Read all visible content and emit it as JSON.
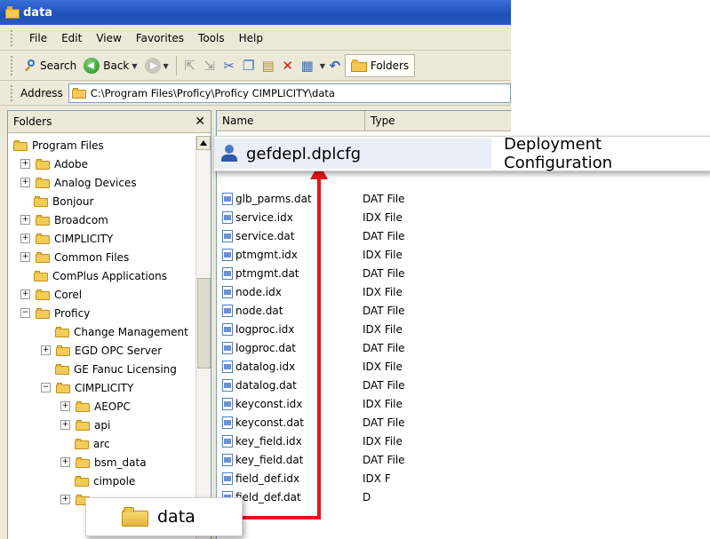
{
  "window": {
    "title": "data"
  },
  "menu": [
    "File",
    "Edit",
    "View",
    "Favorites",
    "Tools",
    "Help"
  ],
  "toolbar": {
    "search_label": "Search",
    "back_label": "Back",
    "folders_label": "Folders"
  },
  "address": {
    "label": "Address",
    "path": "C:\\Program Files\\Proficy\\Proficy CIMPLICITY\\data"
  },
  "folders_pane": {
    "title": "Folders",
    "tree": [
      {
        "label": "Program Files",
        "expander": ""
      },
      {
        "label": "Adobe",
        "expander": "+"
      },
      {
        "label": "Analog Devices",
        "expander": "+"
      },
      {
        "label": "Bonjour",
        "expander": ""
      },
      {
        "label": "Broadcom",
        "expander": "+"
      },
      {
        "label": "CIMPLICITY",
        "expander": "+"
      },
      {
        "label": "Common Files",
        "expander": "+"
      },
      {
        "label": "ComPlus Applications",
        "expander": ""
      },
      {
        "label": "Corel",
        "expander": "+"
      },
      {
        "label": "Proficy",
        "expander": "−"
      },
      {
        "label": "Change Management",
        "expander": ""
      },
      {
        "label": "EGD OPC Server",
        "expander": "+"
      },
      {
        "label": "GE Fanuc Licensing",
        "expander": ""
      },
      {
        "label": "CIMPLICITY",
        "expander": "−"
      },
      {
        "label": "AEOPC",
        "expander": "+"
      },
      {
        "label": "api",
        "expander": "+"
      },
      {
        "label": "arc",
        "expander": ""
      },
      {
        "label": "bsm_data",
        "expander": "+"
      },
      {
        "label": "cimpole",
        "expander": ""
      }
    ]
  },
  "file_list": {
    "columns": [
      "Name",
      "Type"
    ],
    "rows": [
      {
        "name": "glb_parms.dat",
        "type": "DAT File"
      },
      {
        "name": "service.idx",
        "type": "IDX File"
      },
      {
        "name": "service.dat",
        "type": "DAT File"
      },
      {
        "name": "ptmgmt.idx",
        "type": "IDX File"
      },
      {
        "name": "ptmgmt.dat",
        "type": "DAT File"
      },
      {
        "name": "node.idx",
        "type": "IDX File"
      },
      {
        "name": "node.dat",
        "type": "DAT File"
      },
      {
        "name": "logproc.idx",
        "type": "IDX File"
      },
      {
        "name": "logproc.dat",
        "type": "DAT File"
      },
      {
        "name": "datalog.idx",
        "type": "IDX File"
      },
      {
        "name": "datalog.dat",
        "type": "DAT File"
      },
      {
        "name": "keyconst.idx",
        "type": "IDX File"
      },
      {
        "name": "keyconst.dat",
        "type": "DAT File"
      },
      {
        "name": "key_field.idx",
        "type": "IDX File"
      },
      {
        "name": "key_field.dat",
        "type": "DAT File"
      },
      {
        "name": "field_def.idx",
        "type": "IDX F"
      },
      {
        "name": "field_def.dat",
        "type": "D"
      }
    ]
  },
  "callout_file": {
    "name": "gefdepl.dplcfg",
    "type": "Deployment Configuration"
  },
  "callout_folder": {
    "name": "data"
  },
  "colors": {
    "arrow": "#e8141c",
    "titlebar": "#1d4fb8"
  }
}
